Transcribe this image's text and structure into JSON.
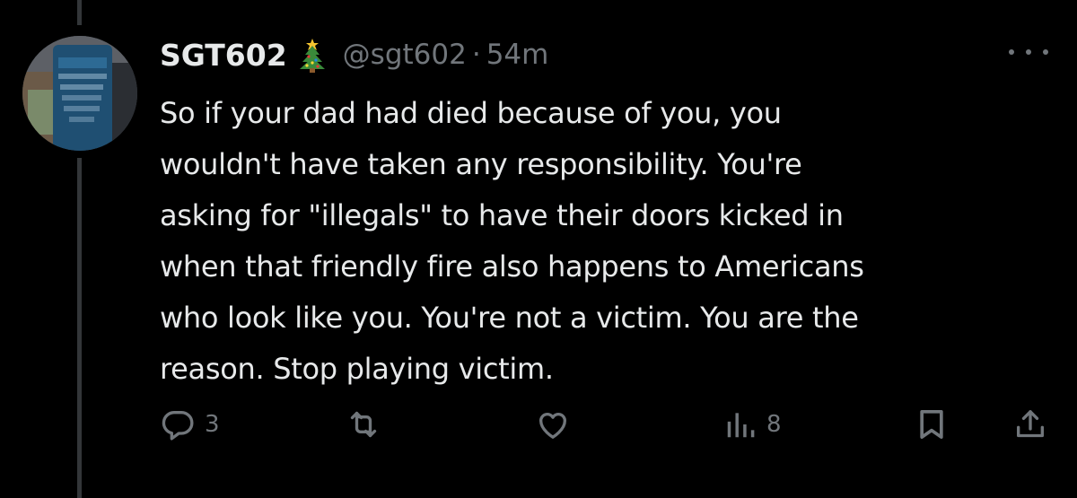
{
  "tweet": {
    "display_name": "SGT602",
    "name_emoji": "christmas-tree-icon",
    "handle": "@sgt602",
    "separator": "·",
    "time": "54m",
    "text": "So if your dad had died because of you, you\nwouldn't have taken any responsibility.  You're\nasking for \"illegals\" to have their doors kicked in\nwhen that friendly fire also happens to Americans\nwho look like you. You're not a victim. You are the\nreason. Stop playing victim."
  },
  "actions": {
    "reply_count": "3",
    "retweet_count": "",
    "like_count": "",
    "views_count": "8"
  },
  "icons": {
    "reply": "reply-icon",
    "retweet": "retweet-icon",
    "like": "heart-icon",
    "views": "views-icon",
    "bookmark": "bookmark-icon",
    "share": "share-icon",
    "more": "more-icon"
  },
  "colors": {
    "background": "#000000",
    "primary_text": "#e7e9ea",
    "secondary_text": "#71767b",
    "thread_line": "#333639"
  }
}
